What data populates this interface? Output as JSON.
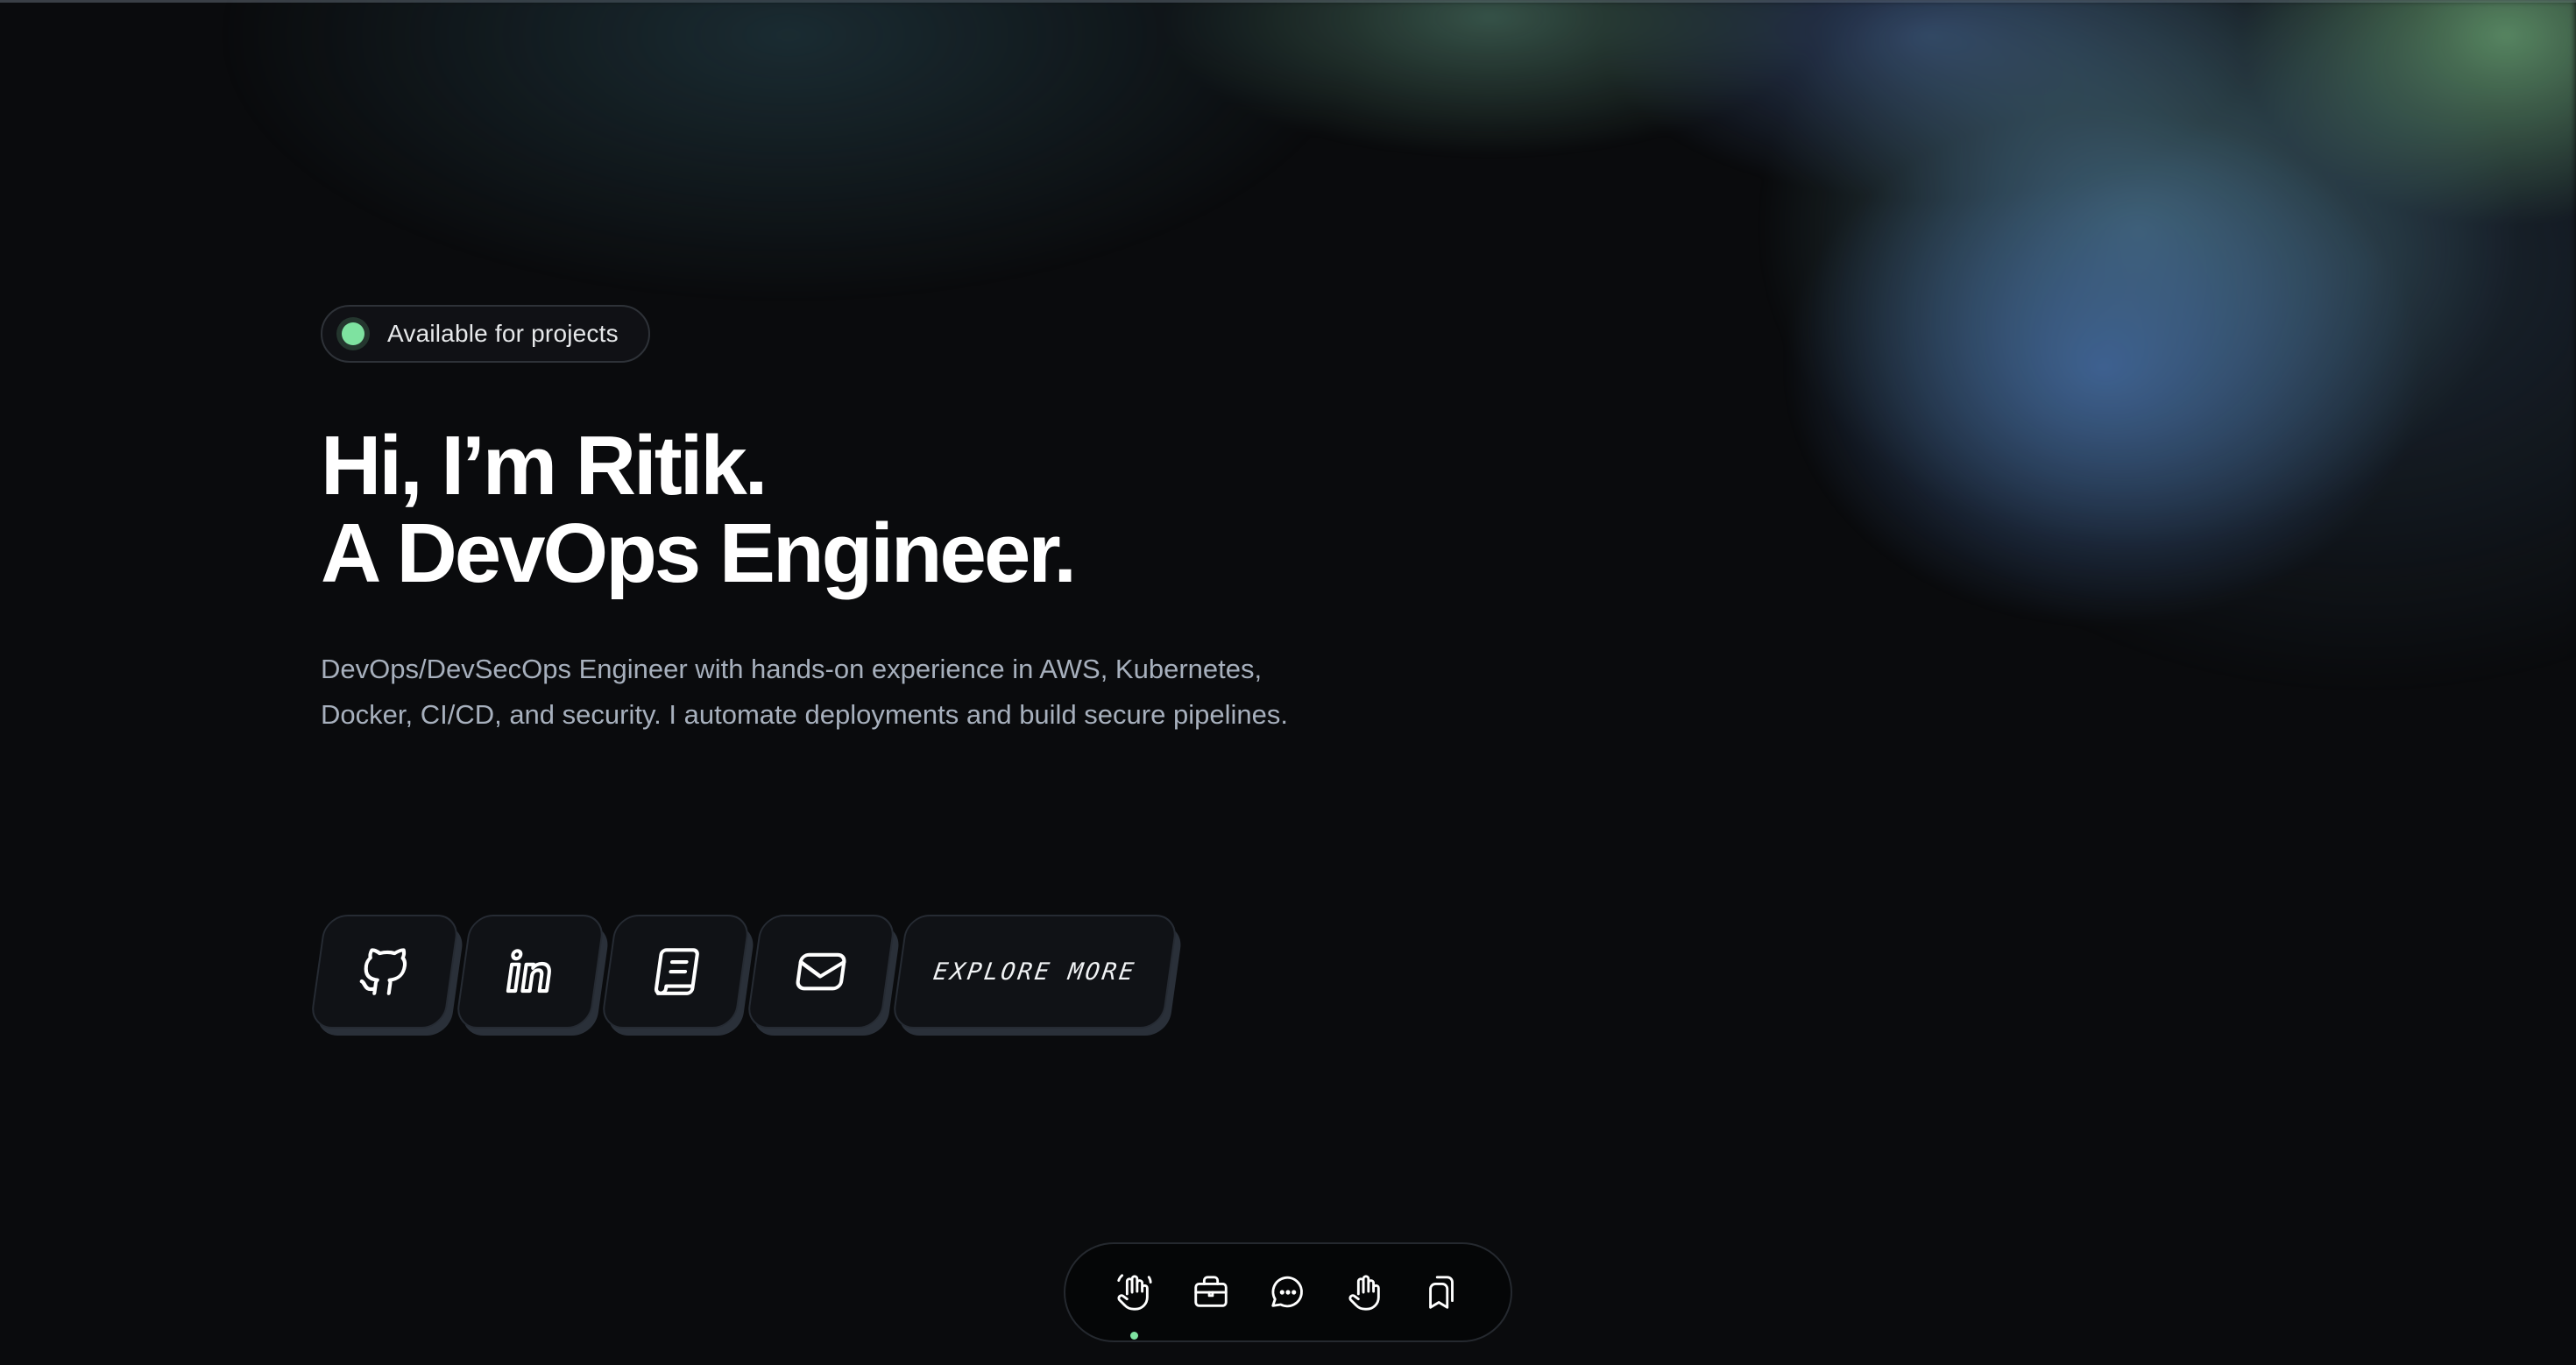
{
  "badge": {
    "text": "Available for projects",
    "dot_color": "#7ee2a0"
  },
  "hero": {
    "line1": "Hi, I’m Ritik.",
    "line2": "A DevOps Engineer.",
    "description": "DevOps/DevSecOps Engineer with hands-on experience in AWS, Kubernetes, Docker, CI/CD, and security. I automate deployments and build secure pipelines."
  },
  "links": [
    {
      "icon": "github-icon"
    },
    {
      "icon": "linkedin-icon"
    },
    {
      "icon": "resume-icon"
    },
    {
      "icon": "mail-icon"
    }
  ],
  "explore_button": {
    "label": "EXPLORE MORE"
  },
  "dock": {
    "items": [
      {
        "icon": "wave-hand-icon",
        "active": true
      },
      {
        "icon": "briefcase-icon",
        "active": false
      },
      {
        "icon": "chat-bubble-icon",
        "active": false
      },
      {
        "icon": "hand-icon",
        "active": false
      },
      {
        "icon": "bookmarks-icon",
        "active": false
      }
    ]
  },
  "colors": {
    "background": "#0a0b0d",
    "accent": "#7ee2a0",
    "text_muted": "#a7b0bd"
  }
}
